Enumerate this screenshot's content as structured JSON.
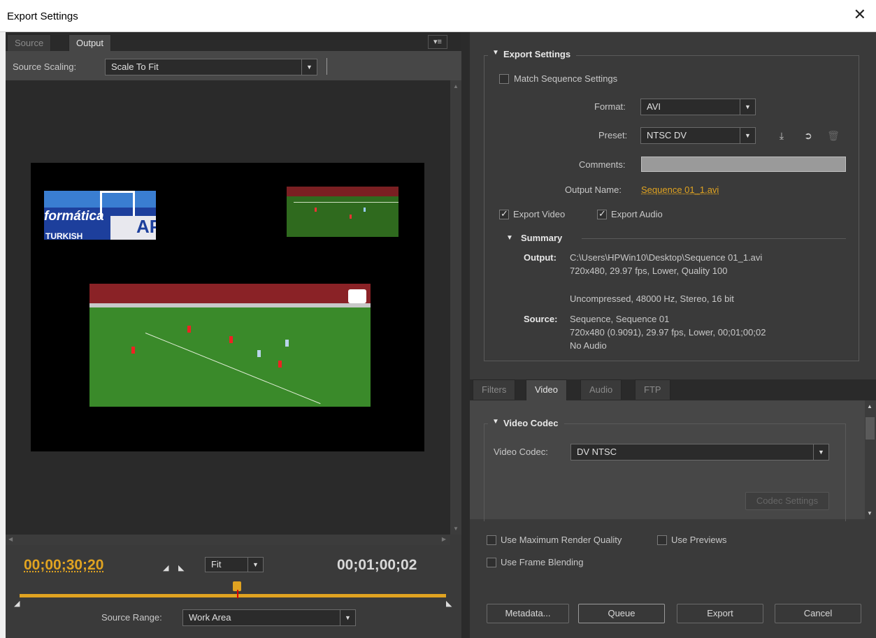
{
  "window": {
    "title": "Export Settings",
    "close_glyph": "✕"
  },
  "left": {
    "tabs": [
      {
        "label": "Source"
      },
      {
        "label": "Output"
      }
    ],
    "panel_menu_glyph": "▾≡",
    "source_scaling": {
      "label": "Source Scaling:",
      "value": "Scale To Fit"
    },
    "clip_texts": {
      "clip1": "formática",
      "clip1b": "AP",
      "clip1c": "TURKISH"
    },
    "timecode_current": "00;00;30;20",
    "timecode_duration": "00;01;00;02",
    "zoom": {
      "value": "Fit"
    },
    "source_range": {
      "label": "Source Range:",
      "value": "Work Area"
    }
  },
  "export_settings": {
    "section_title": "Export Settings",
    "match_sequence_label": "Match Sequence Settings",
    "format_label": "Format:",
    "format_value": "AVI",
    "preset_label": "Preset:",
    "preset_value": "NTSC DV",
    "comments_label": "Comments:",
    "output_name_label": "Output Name:",
    "output_name_value": "Sequence 01_1.avi",
    "export_video_label": "Export Video",
    "export_audio_label": "Export Audio",
    "summary": {
      "title": "Summary",
      "output_label": "Output:",
      "output_lines": [
        "C:\\Users\\HPWin10\\Desktop\\Sequence 01_1.avi",
        "720x480, 29.97 fps, Lower, Quality 100",
        "Uncompressed, 48000 Hz, Stereo, 16 bit"
      ],
      "source_label": "Source:",
      "source_lines": [
        "Sequence, Sequence 01",
        "720x480 (0.9091), 29.97 fps, Lower, 00;01;00;02",
        "No Audio"
      ]
    }
  },
  "bottom_tabs": [
    {
      "label": "Filters"
    },
    {
      "label": "Video"
    },
    {
      "label": "Audio"
    },
    {
      "label": "FTP"
    }
  ],
  "video_codec": {
    "section_title": "Video Codec",
    "label": "Video Codec:",
    "value": "DV NTSC",
    "codec_settings_label": "Codec Settings"
  },
  "options": {
    "max_render_quality": "Use Maximum Render Quality",
    "use_previews": "Use Previews",
    "frame_blending": "Use Frame Blending"
  },
  "buttons": {
    "metadata": "Metadata...",
    "queue": "Queue",
    "export": "Export",
    "cancel": "Cancel"
  },
  "colors": {
    "accent": "#e0a321",
    "panel": "#3a3a3a",
    "field": "#2b2b2b"
  }
}
